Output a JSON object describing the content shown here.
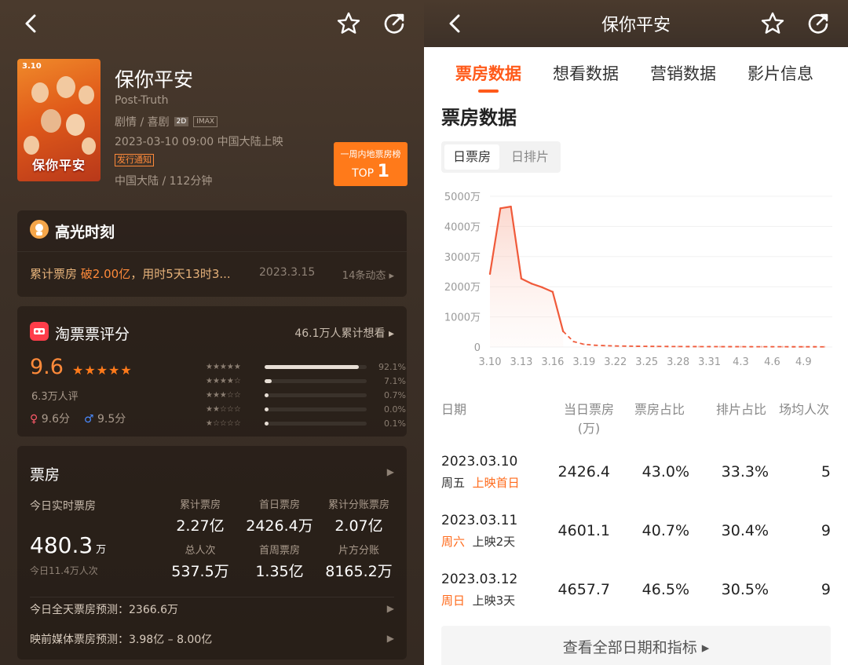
{
  "left": {
    "movie": {
      "poster_date": "3.10",
      "poster_title": "保你平安",
      "title": "保你平安",
      "english_title": "Post-Truth",
      "genres": "剧情 / 喜剧",
      "formats": [
        "2D",
        "IMAX"
      ],
      "release": "2023-03-10 09:00 中国大陆上映",
      "release_tag": "发行通知",
      "region_runtime": "中国大陆 / 112分钟"
    },
    "rank_badge": {
      "line1": "一周内地票房榜",
      "prefix": "TOP",
      "rank": "1"
    },
    "highlight": {
      "title": "高光时刻",
      "text_a": "累计票房 ",
      "text_b": "破2.00亿",
      "text_c": "，用时5天13时3...",
      "date": "2023.3.15",
      "more": "14条动态 ▸"
    },
    "score": {
      "title": "淘票票评分",
      "want": "46.1万人累计想看  ▸",
      "value": "9.6",
      "stars": "★★★★★",
      "count": "6.3万人评",
      "female": "9.6分",
      "male": "9.5分",
      "distribution": [
        {
          "stars": "★★★★★",
          "pct": "92.1%",
          "fill": 0.921
        },
        {
          "stars": "★★★★☆",
          "pct": "7.1%",
          "fill": 0.071
        },
        {
          "stars": "★★★☆☆",
          "pct": "0.7%",
          "fill": 0.04
        },
        {
          "stars": "★★☆☆☆",
          "pct": "0.0%",
          "fill": 0.04
        },
        {
          "stars": "★☆☆☆☆",
          "pct": "0.1%",
          "fill": 0.04
        }
      ]
    },
    "boxoffice": {
      "title": "票房",
      "today_label": "今日实时票房",
      "today_value": "480.3",
      "today_unit": "万",
      "today_people": "今日11.4万人次",
      "stats": [
        {
          "label": "累计票房",
          "value": "2.27亿"
        },
        {
          "label": "首日票房",
          "value": "2426.4万"
        },
        {
          "label": "累计分账票房",
          "value": "2.07亿"
        },
        {
          "label": "总人次",
          "value": "537.5万"
        },
        {
          "label": "首周票房",
          "value": "1.35亿"
        },
        {
          "label": "片方分账",
          "value": "8165.2万"
        }
      ],
      "forecast_today": "今日全天票房预测：2366.6万",
      "forecast_media": "映前媒体票房预测：3.98亿 – 8.00亿"
    }
  },
  "right": {
    "title": "保你平安",
    "tabs": [
      "票房数据",
      "想看数据",
      "营销数据",
      "影片信息"
    ],
    "section_title": "票房数据",
    "segments": [
      "日票房",
      "日排片"
    ],
    "table_headers": [
      "日期",
      "当日票房\n(万)",
      "票房占比",
      "排片占比",
      "场均人次"
    ],
    "rows": [
      {
        "date": "2023.03.10",
        "weekday": "周五",
        "note": "上映首日",
        "weekday_orange": false,
        "note_orange": true,
        "box": "2426.4",
        "share": "43.0%",
        "screen": "33.3%",
        "avg": "5"
      },
      {
        "date": "2023.03.11",
        "weekday": "周六",
        "note": "上映2天",
        "weekday_orange": true,
        "note_orange": false,
        "box": "4601.1",
        "share": "40.7%",
        "screen": "30.4%",
        "avg": "9"
      },
      {
        "date": "2023.03.12",
        "weekday": "周日",
        "note": "上映3天",
        "weekday_orange": true,
        "note_orange": false,
        "box": "4657.7",
        "share": "46.5%",
        "screen": "30.5%",
        "avg": "9"
      }
    ],
    "more_button": "查看全部日期和指标 ▸"
  },
  "chart_data": {
    "type": "line",
    "x": [
      "3.10",
      "3.11",
      "3.12",
      "3.13",
      "3.14",
      "3.15",
      "3.16",
      "3.17",
      "3.18",
      "3.19",
      "3.20",
      "3.21",
      "3.22",
      "3.23",
      "3.24",
      "3.25",
      "3.26",
      "3.27",
      "3.28",
      "3.29",
      "3.30",
      "3.31",
      "4.1",
      "4.2",
      "4.3",
      "4.4",
      "4.5",
      "4.6",
      "4.7",
      "4.8",
      "4.9",
      "4.10",
      "4.11"
    ],
    "x_ticks": [
      "3.10",
      "3.13",
      "3.16",
      "3.19",
      "3.22",
      "3.25",
      "3.28",
      "3.31",
      "4.3",
      "4.6",
      "4.9"
    ],
    "y_ticks": [
      "0",
      "1000万",
      "2000万",
      "3000万",
      "4000万",
      "5000万"
    ],
    "ylim": [
      0,
      5000
    ],
    "series": [
      {
        "values": [
          2426.4,
          4601.1,
          4657.7,
          2270,
          2100,
          1980,
          1830,
          520,
          180,
          90,
          60,
          45,
          35,
          30,
          25,
          22,
          20,
          18,
          16,
          15,
          14,
          13,
          12,
          12,
          11,
          10,
          10,
          9,
          9,
          8,
          8,
          8,
          7
        ]
      }
    ],
    "solid_until_index": 7,
    "line_color": "#f05a3a"
  }
}
